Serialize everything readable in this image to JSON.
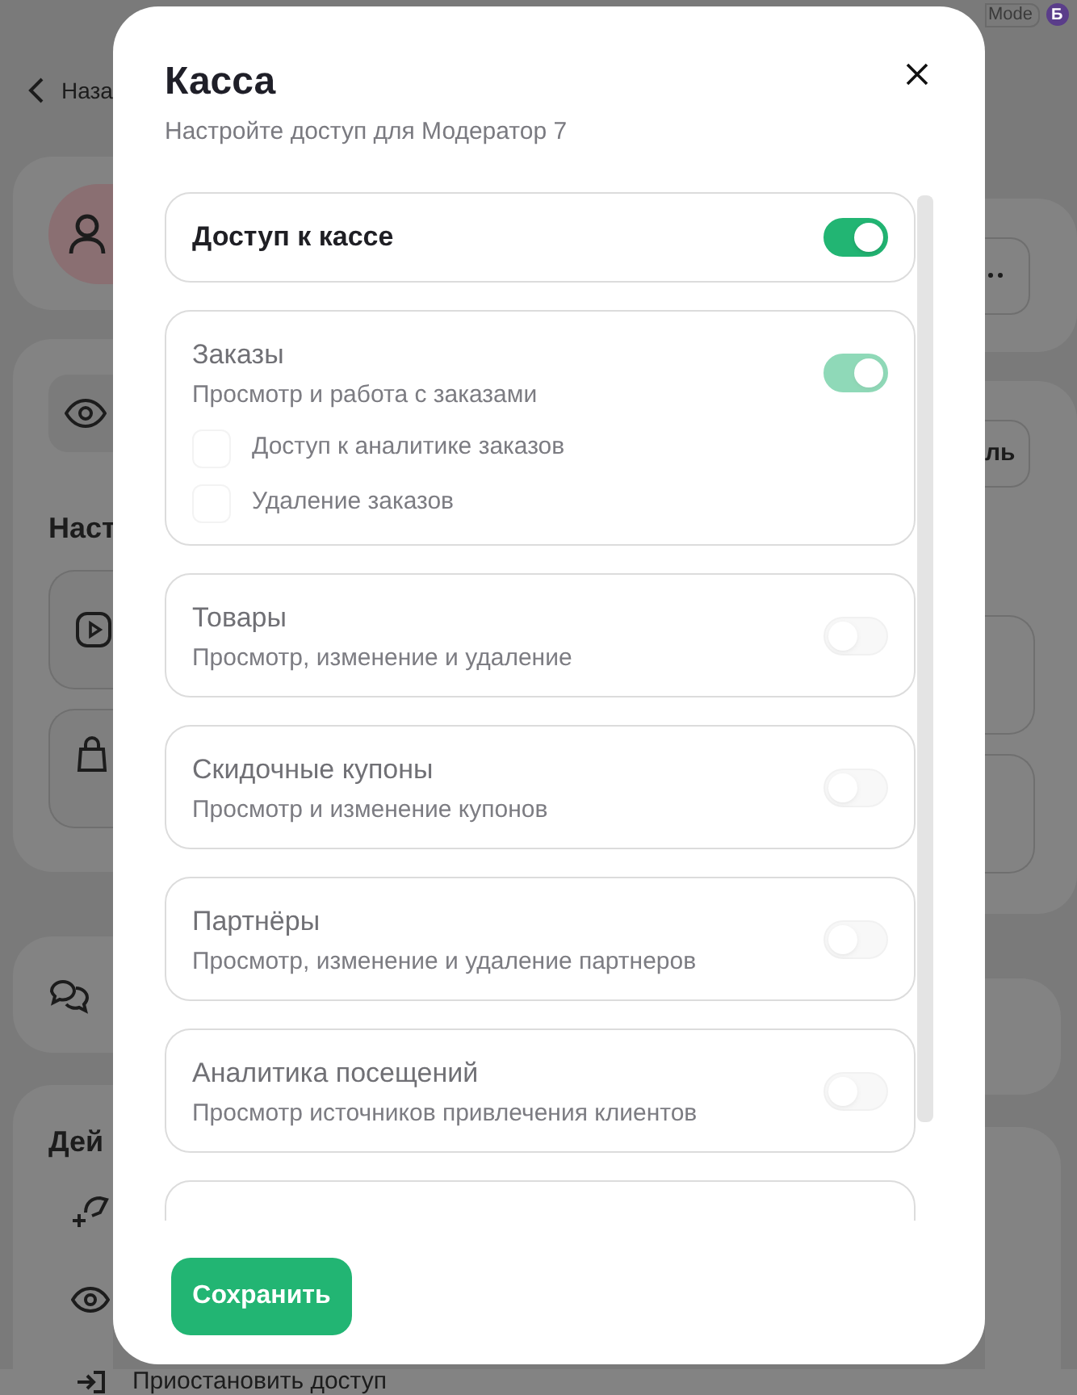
{
  "background": {
    "back_label": "Наза",
    "mode_badge": "Mode",
    "account_letter": "Б",
    "section_fragment": "Наст",
    "actions_fragment": "Дей",
    "button_fragment": "ль",
    "bottom_action": "Приостановить доступ"
  },
  "modal": {
    "title": "Касса",
    "subtitle": "Настройте доступ для Модератор 7",
    "sections": [
      {
        "kind": "master",
        "label": "Доступ к кассе",
        "on": true,
        "disabled": false
      },
      {
        "kind": "group",
        "title": "Заказы",
        "description": "Просмотр и работа с заказами",
        "on": true,
        "disabled": true,
        "options": [
          {
            "label": "Доступ к аналитике заказов",
            "checked": false
          },
          {
            "label": "Удаление заказов",
            "checked": false
          }
        ]
      },
      {
        "kind": "group",
        "title": "Товары",
        "description": "Просмотр, изменение и удаление",
        "on": false,
        "disabled": true
      },
      {
        "kind": "group",
        "title": "Скидочные купоны",
        "description": "Просмотр и изменение купонов",
        "on": false,
        "disabled": true
      },
      {
        "kind": "group",
        "title": "Партнёры",
        "description": "Просмотр, изменение и удаление партнеров",
        "on": false,
        "disabled": true
      },
      {
        "kind": "group",
        "title": "Аналитика посещений",
        "description": "Просмотр источников привлечения клиентов",
        "on": false,
        "disabled": true
      }
    ],
    "save_button": "Сохранить"
  }
}
